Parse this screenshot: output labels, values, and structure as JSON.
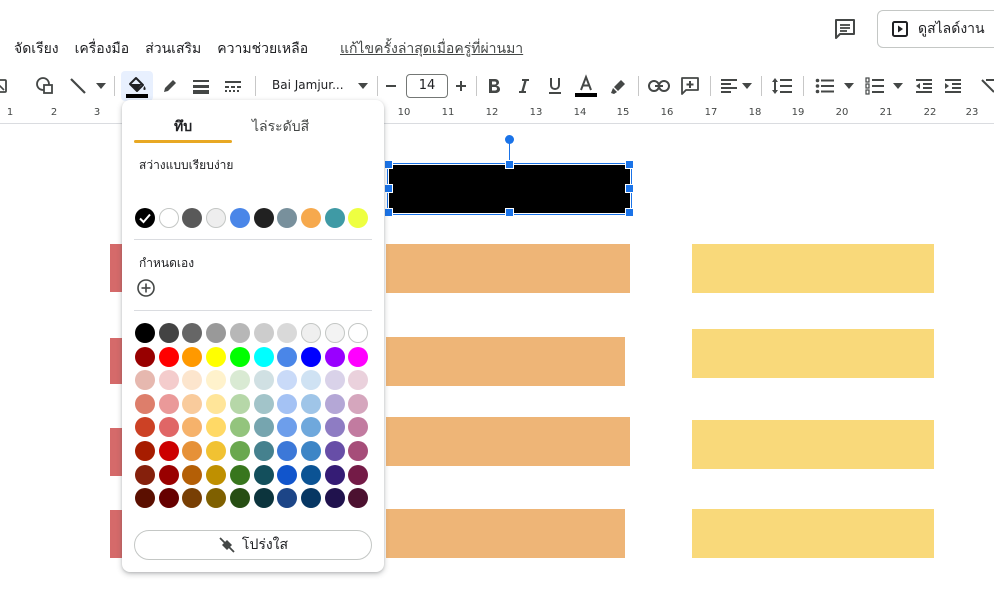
{
  "menu": {
    "items": [
      "จัดเรียง",
      "เครื่องมือ",
      "ส่วนเสริม",
      "ความช่วยเหลือ"
    ],
    "last_edit": "แก้ไขครั้งล่าสุดเมื่อครู่ที่ผ่านมา"
  },
  "header": {
    "slideshow_label": "ดูสไลด์งาน"
  },
  "toolbar": {
    "font_name": "Bai Jamjur...",
    "font_size": "14",
    "text_color": "#000000"
  },
  "ruler": {
    "numbers": [
      "1",
      "2",
      "3",
      "10",
      "11",
      "12",
      "13",
      "14",
      "15",
      "16",
      "17",
      "18",
      "19",
      "20",
      "21",
      "22",
      "23"
    ]
  },
  "popup": {
    "tabs": [
      "ทึบ",
      "ไล่ระดับสี"
    ],
    "active_tab": "ทึบ",
    "simple_light_label": "สว่างแบบเรียบง่าย",
    "custom_label": "กำหนดเอง",
    "transparent_label": "โปร่งใส",
    "theme_colors": [
      "#000000",
      "#ffffff",
      "#595959",
      "#eeeeee",
      "#4a86e8",
      "#212121",
      "#78909c",
      "#f6a94d",
      "#3f9aa5",
      "#eeff41"
    ],
    "selected_theme_color": "#000000",
    "palette": [
      [
        "#000000",
        "#434343",
        "#666666",
        "#999999",
        "#b7b7b7",
        "#cccccc",
        "#d9d9d9",
        "#efefef",
        "#f3f3f3",
        "#ffffff"
      ],
      [
        "#980000",
        "#ff0000",
        "#ff9900",
        "#ffff00",
        "#00ff00",
        "#00ffff",
        "#4a86e8",
        "#0000ff",
        "#9900ff",
        "#ff00ff"
      ],
      [
        "#e6b8af",
        "#f4cccc",
        "#fce5cd",
        "#fff2cc",
        "#d9ead3",
        "#d0e0e3",
        "#c9daf8",
        "#cfe2f3",
        "#d9d2e9",
        "#ead1dc"
      ],
      [
        "#dd7e6b",
        "#ea9999",
        "#f9cb9c",
        "#ffe599",
        "#b6d7a8",
        "#a2c4c9",
        "#a4c2f4",
        "#9fc5e8",
        "#b4a7d6",
        "#d5a6bd"
      ],
      [
        "#cc4125",
        "#e06666",
        "#f6b26b",
        "#ffd966",
        "#93c47d",
        "#76a5af",
        "#6d9eeb",
        "#6fa8dc",
        "#8e7cc3",
        "#c27ba0"
      ],
      [
        "#a61c00",
        "#cc0000",
        "#e69138",
        "#f1c232",
        "#6aa84f",
        "#45818e",
        "#3c78d8",
        "#3d85c6",
        "#674ea7",
        "#a64d79"
      ],
      [
        "#85200c",
        "#990000",
        "#b45f06",
        "#bf9000",
        "#38761d",
        "#134f5c",
        "#1155cc",
        "#0b5394",
        "#351c75",
        "#741b47"
      ],
      [
        "#5b0f00",
        "#660000",
        "#783f04",
        "#7f6000",
        "#274e13",
        "#0c343d",
        "#1c4587",
        "#073763",
        "#20124d",
        "#4c1130"
      ]
    ]
  },
  "slide": {
    "selected_box_color": "#000000",
    "selection_color": "#1a73e8",
    "left_column_color": "#d56a6a",
    "middle_column_color": "#eeb577",
    "right_column_color": "#f9d97a"
  }
}
